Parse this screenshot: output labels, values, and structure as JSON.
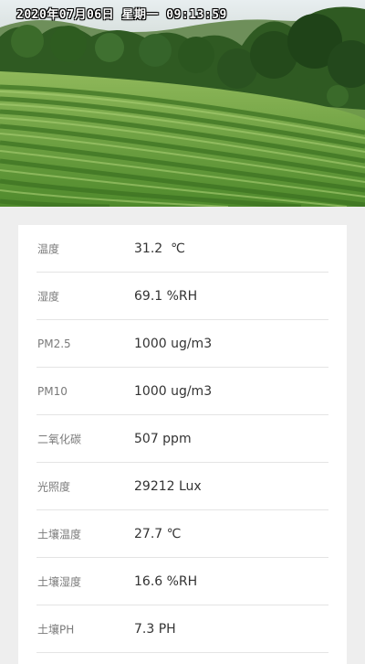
{
  "camera": {
    "timestamp": "2020年07月06日  星期一  09:13:59"
  },
  "readings": [
    {
      "label": "温度",
      "value": "31.2  ℃"
    },
    {
      "label": "湿度",
      "value": "69.1 %RH"
    },
    {
      "label": "PM2.5",
      "value": "1000 ug/m3"
    },
    {
      "label": "PM10",
      "value": "1000 ug/m3"
    },
    {
      "label": "二氧化碳",
      "value": "507 ppm"
    },
    {
      "label": "光照度",
      "value": "29212 Lux"
    },
    {
      "label": "土壤温度",
      "value": "27.7 ℃"
    },
    {
      "label": "土壤湿度",
      "value": "16.6 %RH"
    },
    {
      "label": "土壤PH",
      "value": "7.3 PH"
    }
  ]
}
